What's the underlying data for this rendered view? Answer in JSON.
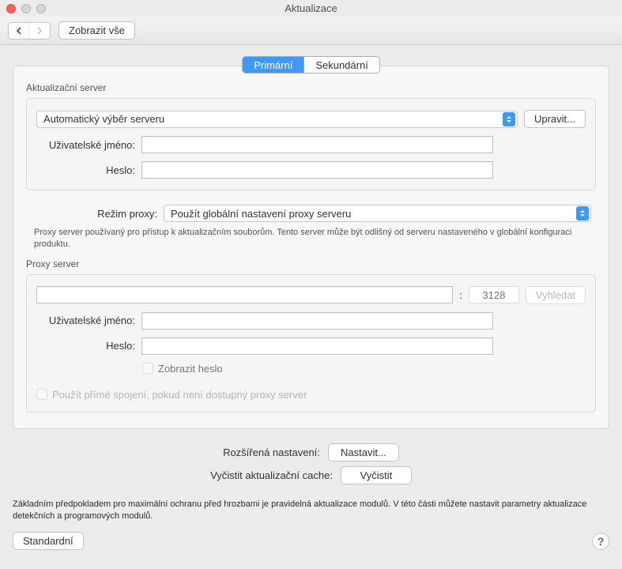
{
  "window": {
    "title": "Aktualizace"
  },
  "toolbar": {
    "show_all": "Zobrazit vše"
  },
  "tabs": {
    "primary": "Primární",
    "secondary": "Sekundární"
  },
  "update_server": {
    "label": "Aktualizační server",
    "select_value": "Automatický výběr serveru",
    "edit_button": "Upravit...",
    "username_label": "Uživatelské jméno:",
    "password_label": "Heslo:"
  },
  "proxy_mode": {
    "label": "Režim proxy:",
    "value": "Použít globální nastavení proxy serveru",
    "help": "Proxy server používaný pro přístup k aktualizačním souborům. Tento server může být odlišný od serveru nastaveného v globální konfiguraci produktu."
  },
  "proxy_server": {
    "label": "Proxy server",
    "port_placeholder": "3128",
    "lookup_button": "Vyhledat",
    "username_label": "Uživatelské jméno:",
    "password_label": "Heslo:",
    "show_password": "Zobrazit heslo",
    "direct_fallback": "Použít přímé spojení, pokud není dostupný proxy server"
  },
  "advanced": {
    "settings_label": "Rozšířená nastavení:",
    "settings_button": "Nastavit...",
    "clear_cache_label": "Vyčistit aktualizační cache:",
    "clear_cache_button": "Vyčistit"
  },
  "description": "Základním předpokladem pro maximální ochranu před hrozbami je pravidelná aktualizace modulů. V této části můžete nastavit parametry aktualizace detekčních a programových modulů.",
  "footer": {
    "standard_button": "Standardní",
    "help": "?"
  }
}
